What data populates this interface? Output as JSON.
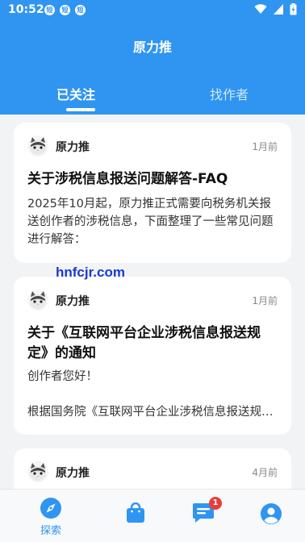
{
  "status_bar": {
    "time": "10:52",
    "notification_badges": [
      "短",
      "短",
      "短"
    ]
  },
  "header": {
    "title": "原力推",
    "tabs": [
      {
        "label": "已关注",
        "active": true
      },
      {
        "label": "找作者",
        "active": false
      }
    ]
  },
  "feed": {
    "posts": [
      {
        "author": "原力推",
        "time": "1月前",
        "title": "关于涉税信息报送问题解答-FAQ",
        "body": "2025年10月起，原力推正式需要向税务机关报送创作者的涉税信息，下面整理了一些常见问题进行解答："
      },
      {
        "author": "原力推",
        "time": "1月前",
        "title": "关于《互联网平台企业涉税信息报送规定》的通知",
        "body": "创作者您好！",
        "body2": "根据国务院《互联网平台企业涉税信息报送规定》"
      },
      {
        "author": "原力推",
        "time": "4月前"
      }
    ]
  },
  "watermark": "hnfcjr.com",
  "bottom_nav": {
    "items": [
      {
        "label": "探索",
        "icon": "compass-icon",
        "active": true
      },
      {
        "label": "",
        "icon": "shopping-bag-icon",
        "active": false
      },
      {
        "label": "",
        "icon": "message-icon",
        "active": false,
        "badge": "1"
      },
      {
        "label": "",
        "icon": "profile-icon",
        "active": false
      }
    ]
  },
  "colors": {
    "primary": "#2f95f1",
    "badge": "#ee3a3a",
    "background": "#f2f3f5"
  }
}
